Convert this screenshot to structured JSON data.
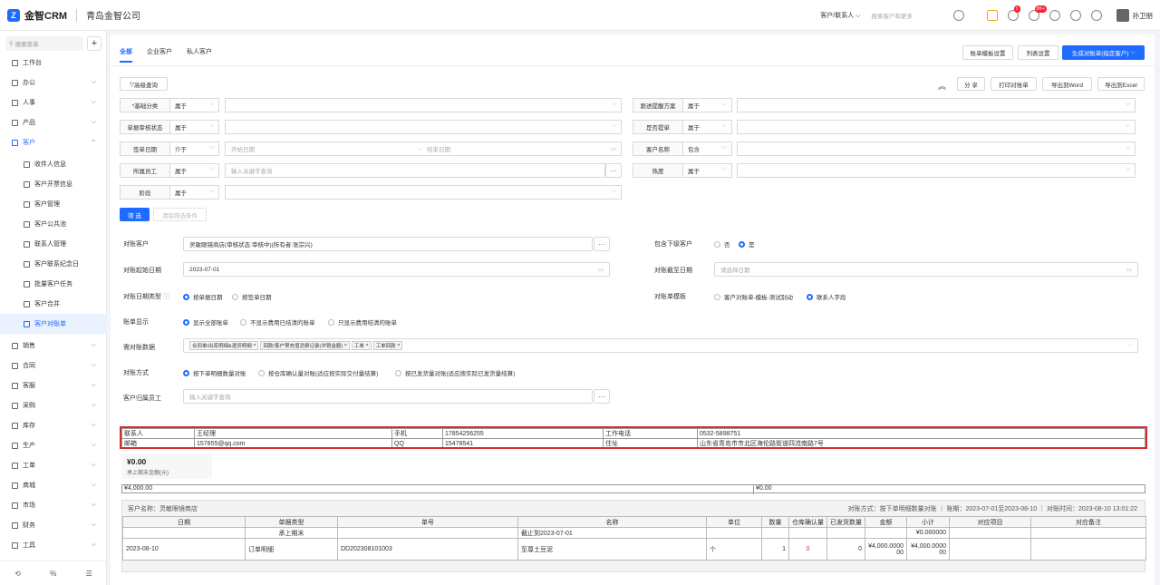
{
  "topbar": {
    "logo_text": "金智CRM",
    "company": "青岛金智公司",
    "search_select": "客户/联系人",
    "search_placeholder": "搜索客户和更多",
    "badge_1": "1",
    "badge_2": "99+",
    "user_name": "孙卫朋"
  },
  "sidebar": {
    "search_placeholder": "搜索菜单",
    "add": "+",
    "items": [
      {
        "label": "工作台",
        "icon": "home-icon"
      },
      {
        "label": "办公",
        "icon": "office-icon"
      },
      {
        "label": "人事",
        "icon": "people-icon"
      },
      {
        "label": "产品",
        "icon": "product-icon"
      },
      {
        "label": "客户",
        "icon": "customer-icon"
      }
    ],
    "sub_items": [
      "收件人信息",
      "客户开票信息",
      "客户管理",
      "客户公共池",
      "联系人管理",
      "客户联系纪念日",
      "批量客户任务",
      "客户合并",
      "客户对账单"
    ],
    "bottom_items": [
      "销售",
      "合同",
      "客服",
      "采购",
      "库存",
      "生产",
      "工单",
      "商城",
      "市场",
      "财务",
      "工具"
    ],
    "footer": [
      "⟲",
      "%",
      "☰"
    ]
  },
  "tabs": [
    "全部",
    "企业客户",
    "私人客户"
  ],
  "buttons": {
    "template_settings": "账单模板设置",
    "list_settings": "列表设置",
    "generate": "生成对账单(指定客户)",
    "advanced": "高级查询",
    "share": "分 享",
    "print": "打印对账单",
    "export_word": "导出到Word",
    "export_excel": "导出到Excel",
    "filter": "筛 选",
    "clear": "清除筛选条件"
  },
  "filters": {
    "basic_category": "*基础分类",
    "follow_plan": "跟进提醒方案",
    "review_status": "单据审核状态",
    "is_signed": "是否提单",
    "sign_date": "签单日期",
    "customer_name": "客户名称",
    "staff": "所属员工",
    "heat": "热度",
    "stage": "阶段",
    "op_belong": "属于",
    "op_between": "介于",
    "op_contain": "包含",
    "start_date": "开始日期",
    "arrow": "→",
    "end_date": "结束日期",
    "keyword_placeholder": "输入关键字查询"
  },
  "form": {
    "customer_label": "对账客户",
    "customer_value": "灵敏眼镜商店(审核状态:审核中)(所有者:张宗兴)",
    "include_sub_label": "包含下级客户",
    "no": "否",
    "yes": "是",
    "start_date_label": "对账起始日期",
    "start_date_value": "2023-07-01",
    "end_date_label": "对账截至日期",
    "end_date_placeholder": "请选择日期",
    "date_type_label": "对账日期类型",
    "by_doc_date": "按单据日期",
    "by_sign_date": "按签单日期",
    "template_label": "对账单模板",
    "template_opt1": "客户对账单-模板-测试别动",
    "template_opt2": "联系人字段",
    "display_label": "账单显示",
    "display_opt1": "显示全部账单",
    "display_opt2": "不显示费用已结清的账单",
    "display_opt3": "只显示费用结清的账单",
    "data_label": "需对账数据",
    "tags": [
      "合同单/出库明细&退货明细",
      "回款/客户预充值消费记录(冲销金额)",
      "工单",
      "工单回款"
    ],
    "method_label": "对账方式",
    "method_opt1": "按下单明细数量对账",
    "method_opt2": "按仓库确认量对账(适应按实际交付量结算)",
    "method_opt3": "按已发货量对账(适应按实际已发货量结算)",
    "owner_label": "客户归属员工",
    "owner_placeholder": "输入关键字查询"
  },
  "contact_info": {
    "row1": [
      "联系人",
      "王经理",
      "手机",
      "17854256255",
      "工作电话",
      "0532-5898751"
    ],
    "row2": [
      "邮箱",
      "157855@qq.com",
      "QQ",
      "15478541",
      "住址",
      "山东省青岛市市北区海伦路街道四流南路7号"
    ]
  },
  "amount": {
    "value": "¥0.00",
    "label": "承上期末金额(元)"
  },
  "totals": {
    "left": "¥4,000.00",
    "right": "¥0.00"
  },
  "statement": {
    "customer": "客户名称：灵敏眼镜商店",
    "meta": "对账方式：按下单明细数量对账 ｜ 账期：2023-07-01至2023-08-10 ｜ 对账时间：2023-08-10 13:01:22",
    "headers": [
      "日期",
      "单据类型",
      "单号",
      "名称",
      "单位",
      "数量",
      "仓库确认量",
      "已发货数量",
      "金额",
      "小计",
      "对应项目",
      "对应备注"
    ],
    "row_carry": [
      "",
      "承上期末",
      "",
      "截止到2023-07-01",
      "",
      "",
      "",
      "",
      "",
      "¥0.000000",
      "",
      ""
    ],
    "row1": [
      "2023-08-10",
      "订单明细",
      "DD202308101003",
      "至尊土豆泥",
      "个",
      "1",
      "0",
      "0",
      "¥4,000.000000",
      "¥4,000.000000",
      "",
      ""
    ]
  }
}
